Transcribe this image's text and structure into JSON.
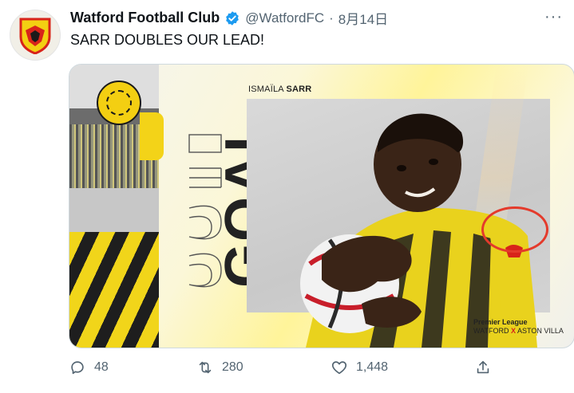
{
  "tweet": {
    "display_name": "Watford Football Club",
    "handle": "@WatfordFC",
    "separator": "·",
    "date": "8月14日",
    "more": "···",
    "text": "SARR DOUBLES OUR LEAD!"
  },
  "media": {
    "goal_word": "GOAL",
    "player_first": "ISMAÏLA",
    "player_last": "SARR",
    "league_line": "Premier League",
    "home_team": "WATFORD",
    "vs": "X",
    "away_team": "ASTON VILLA"
  },
  "actions": {
    "reply_count": "48",
    "retweet_count": "280",
    "like_count": "1,448"
  },
  "colors": {
    "verified": "#1d9bf0",
    "club_yellow": "#f3cf12",
    "club_red": "#d8231a",
    "highlight": "#e43a2b",
    "muted": "#536471"
  },
  "icons": [
    "watford-crest-icon",
    "verified-badge-icon",
    "more-options-icon",
    "reply-icon",
    "retweet-icon",
    "like-icon",
    "share-icon"
  ]
}
